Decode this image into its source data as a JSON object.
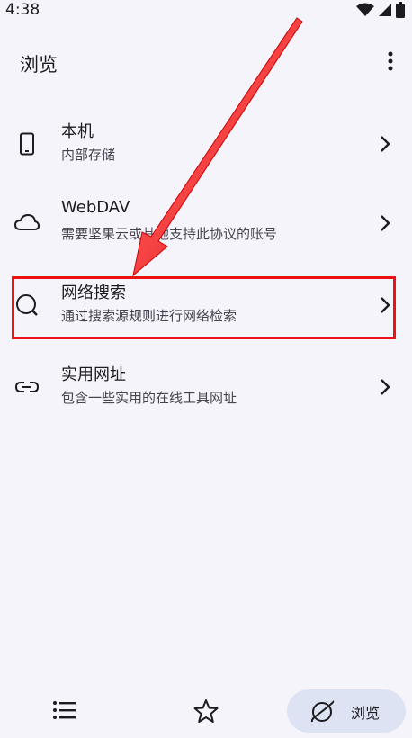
{
  "status": {
    "time": "4:38",
    "icons": [
      "wifi-icon",
      "signal-icon",
      "battery-icon"
    ]
  },
  "app_bar": {
    "title": "浏览",
    "menu_icon": "more-vert-icon"
  },
  "items": [
    {
      "icon": "phone-icon",
      "title": "本机",
      "subtitle": "内部存储"
    },
    {
      "icon": "cloud-icon",
      "title": "WebDAV",
      "subtitle": "需要坚果云或其他支持此协议的账号"
    },
    {
      "icon": "search-icon",
      "title": "网络搜索",
      "subtitle": "通过搜索源规则进行网络检索"
    },
    {
      "icon": "link-icon",
      "title": "实用网址",
      "subtitle": "包含一些实用的在线工具网址"
    }
  ],
  "bottom_nav": {
    "list_icon": "list-icon",
    "star_icon": "star-icon",
    "browse_label": "浏览",
    "browse_icon": "planet-icon"
  },
  "annotation": {
    "color": "#e11111"
  }
}
